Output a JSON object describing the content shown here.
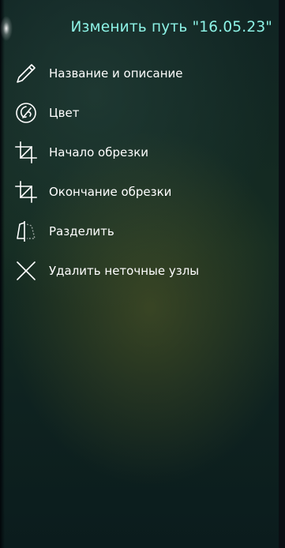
{
  "header": {
    "title": "Изменить путь \"16.05.23\""
  },
  "menu": {
    "items": [
      {
        "label": "Название и описание",
        "icon": "pencil-icon"
      },
      {
        "label": "Цвет",
        "icon": "palette-icon"
      },
      {
        "label": "Начало обрезки",
        "icon": "crop-start-icon"
      },
      {
        "label": "Окончание обрезки",
        "icon": "crop-end-icon"
      },
      {
        "label": "Разделить",
        "icon": "split-icon"
      },
      {
        "label": "Удалить неточные узлы",
        "icon": "delete-x-icon"
      }
    ]
  },
  "colors": {
    "title": "#8df3e6",
    "text": "#ffffff",
    "background": "#12261f"
  }
}
